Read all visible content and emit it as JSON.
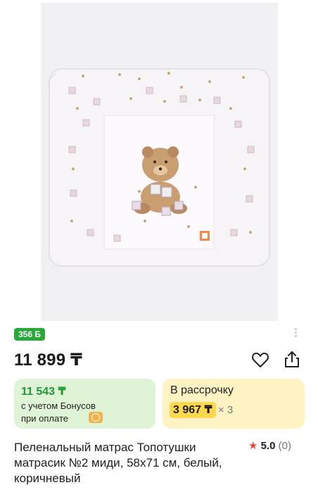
{
  "product": {
    "image_alt": "changing mat with teddy bear print",
    "bonus_badge": "356 Б",
    "price": "11 899 ₸",
    "bonus_card": {
      "price": "11 543 ₸",
      "line1": "с учетом Бонусов",
      "line2": "при оплате"
    },
    "installment_card": {
      "title": "В рассрочку",
      "amount": "3 967 ₸",
      "multiplier": "× 3"
    },
    "title": "Пеленальный матрас Топотушки матрасик №2 миди, 58x71 см, белый, коричневый",
    "rating": "5.0",
    "reviews": "(0)"
  },
  "icons": {
    "favorite": "heart-icon",
    "share": "share-icon",
    "rating_star": "star-icon",
    "carousel": "pagination-dots"
  },
  "colors": {
    "bonus_green": "#2aa83a",
    "green_card": "#dff3d7",
    "yellow_card": "#fff3c4",
    "yellow_chip": "#ffd84d",
    "star_red": "#e8453c"
  }
}
